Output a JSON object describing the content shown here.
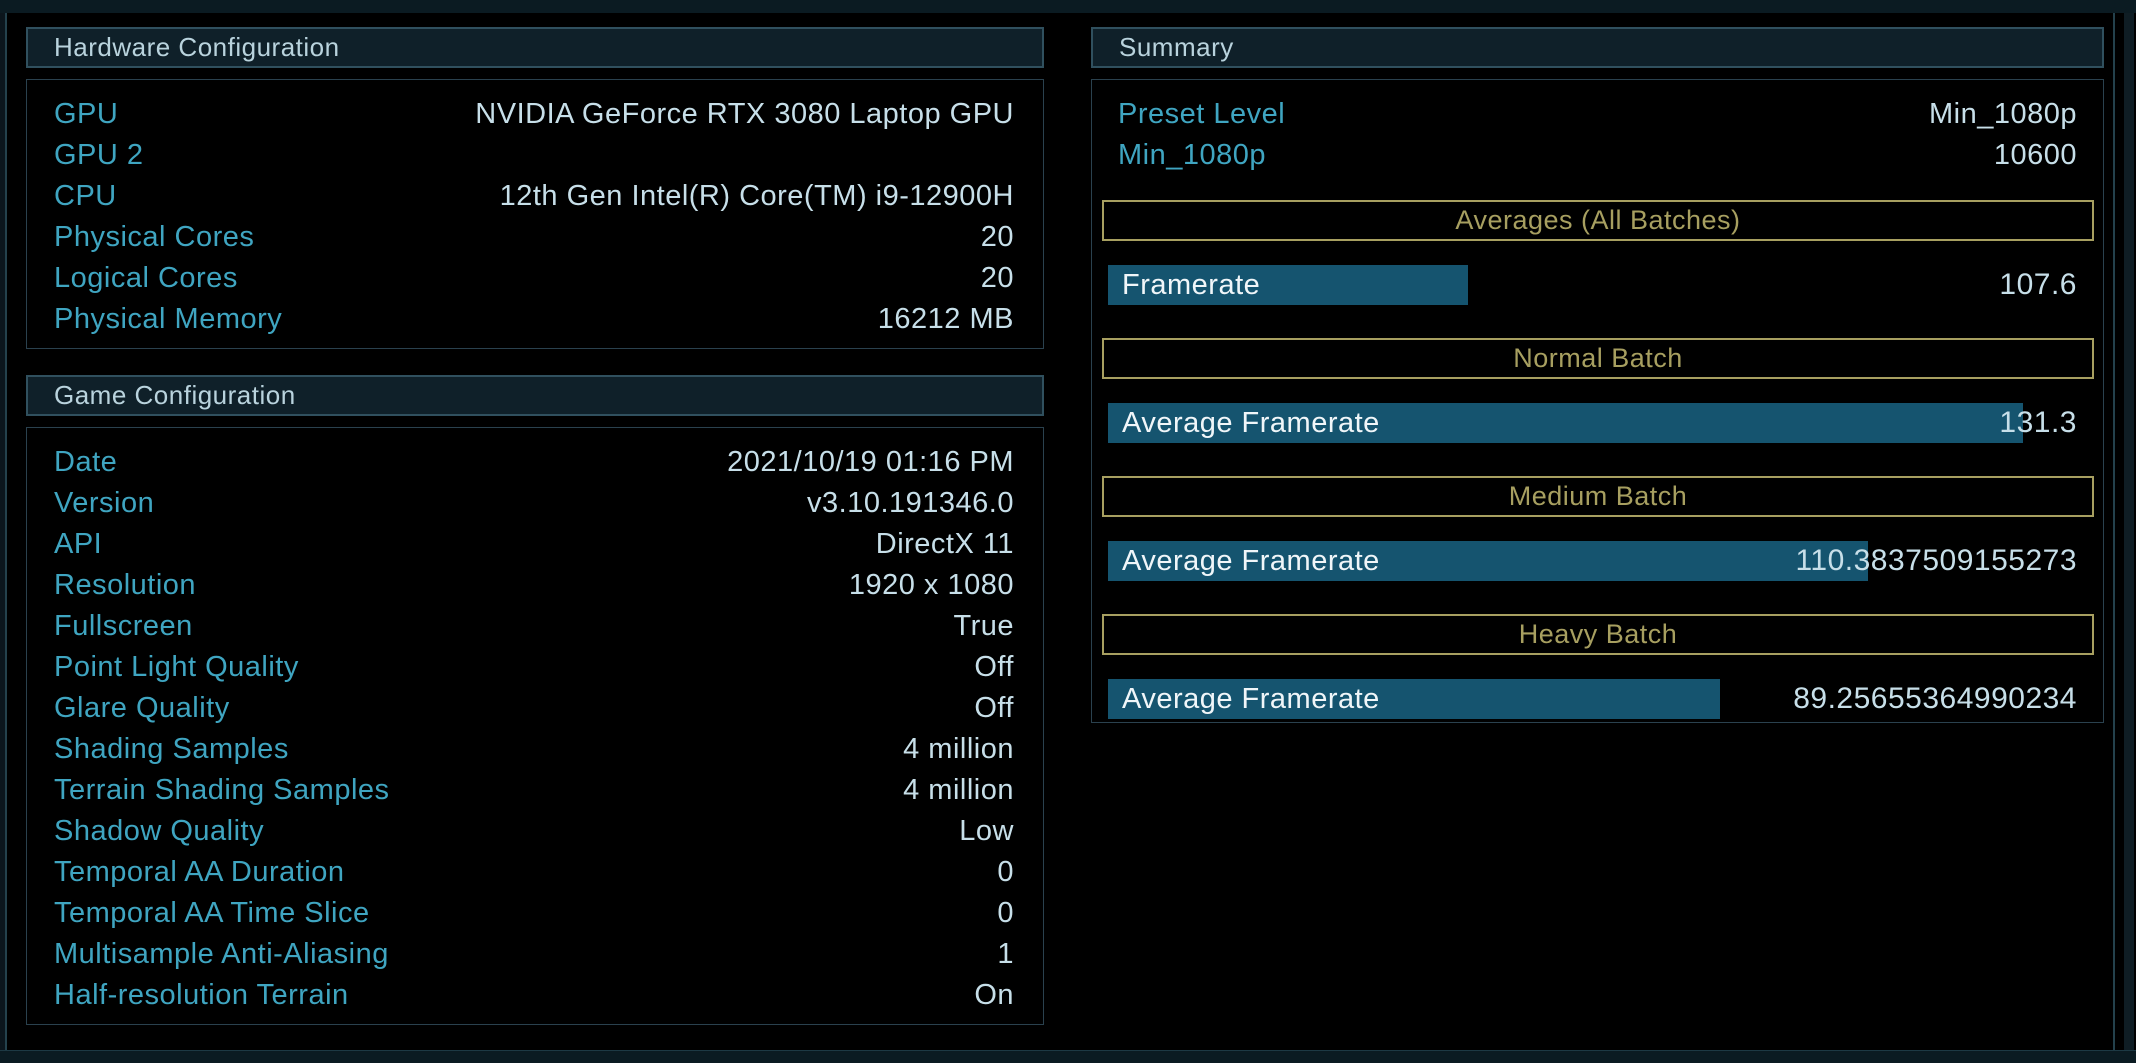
{
  "hardware_configuration": {
    "title": "Hardware Configuration",
    "rows": [
      {
        "label": "GPU",
        "value": "NVIDIA GeForce RTX 3080 Laptop GPU"
      },
      {
        "label": "GPU 2",
        "value": ""
      },
      {
        "label": "CPU",
        "value": "12th Gen Intel(R) Core(TM) i9-12900H"
      },
      {
        "label": "Physical Cores",
        "value": "20"
      },
      {
        "label": "Logical Cores",
        "value": "20"
      },
      {
        "label": "Physical Memory",
        "value": "16212 MB"
      }
    ]
  },
  "game_configuration": {
    "title": "Game Configuration",
    "rows": [
      {
        "label": "Date",
        "value": "2021/10/19 01:16 PM"
      },
      {
        "label": "Version",
        "value": "v3.10.191346.0"
      },
      {
        "label": "API",
        "value": "DirectX 11"
      },
      {
        "label": "Resolution",
        "value": "1920 x 1080"
      },
      {
        "label": "Fullscreen",
        "value": "True"
      },
      {
        "label": "Point Light Quality",
        "value": "Off"
      },
      {
        "label": "Glare Quality",
        "value": "Off"
      },
      {
        "label": "Shading Samples",
        "value": "4 million"
      },
      {
        "label": "Terrain Shading Samples",
        "value": "4 million"
      },
      {
        "label": "Shadow Quality",
        "value": "Low"
      },
      {
        "label": "Temporal AA Duration",
        "value": "0"
      },
      {
        "label": "Temporal AA Time Slice",
        "value": "0"
      },
      {
        "label": "Multisample Anti-Aliasing",
        "value": "1"
      },
      {
        "label": "Half-resolution Terrain",
        "value": "On"
      }
    ]
  },
  "summary": {
    "title": "Summary",
    "rows": [
      {
        "label": "Preset Level",
        "value": "Min_1080p"
      },
      {
        "label": "Min_1080p",
        "value": "10600"
      }
    ],
    "sections": [
      {
        "header": "Averages (All Batches)",
        "bar_label": "Framerate",
        "value": "107.6",
        "bar_pct": 35.6
      },
      {
        "header": "Normal Batch",
        "bar_label": "Average Framerate",
        "value": "131.3",
        "bar_pct": 90.5
      },
      {
        "header": "Medium Batch",
        "bar_label": "Average Framerate",
        "value": "110.3837509155273",
        "bar_pct": 75.2
      },
      {
        "header": "Heavy Batch",
        "bar_label": "Average Framerate",
        "value": "89.25655364990234",
        "bar_pct": 60.5
      }
    ]
  },
  "colors": {
    "label_cyan": "#3fa5c1",
    "value_text": "#c7dfe9",
    "panel_header_bg": "#0f2029",
    "panel_header_border": "#30505e",
    "batch_gold": "#a79f60",
    "bar_fill": "#15546f",
    "bar_label_text": "#f0f6f9",
    "background": "#000000",
    "chrome_strip": "#0b1b22"
  }
}
